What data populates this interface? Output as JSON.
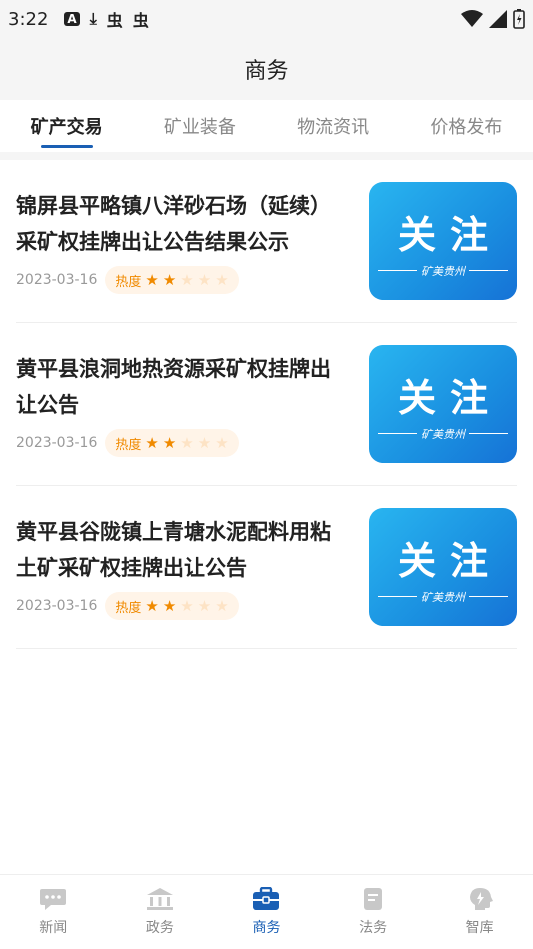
{
  "status_bar": {
    "time": "3:22",
    "left_icons": [
      "A",
      "⤓",
      "虫",
      "虫"
    ]
  },
  "header": {
    "title": "商务"
  },
  "tabs": [
    {
      "label": "矿产交易",
      "active": true
    },
    {
      "label": "矿业装备",
      "active": false
    },
    {
      "label": "物流资讯",
      "active": false
    },
    {
      "label": "价格发布",
      "active": false
    }
  ],
  "items": [
    {
      "title_line1": "锦屏县平略镇八洋砂石场（延续）",
      "title_line2": "采矿权挂牌出让公告结果公示",
      "date": "2023-03-16",
      "heat_label": "热度",
      "heat_stars": 2,
      "thumb_main": "关注",
      "thumb_sub": "矿美贵州"
    },
    {
      "title_line1": "黄平县浪洞地热资源采矿权挂牌出",
      "title_line2": "让公告",
      "date": "2023-03-16",
      "heat_label": "热度",
      "heat_stars": 2,
      "thumb_main": "关注",
      "thumb_sub": "矿美贵州"
    },
    {
      "title_line1": "黄平县谷陇镇上青塘水泥配料用粘",
      "title_line2": "土矿采矿权挂牌出让公告",
      "date": "2023-03-16",
      "heat_label": "热度",
      "heat_stars": 2,
      "thumb_main": "关注",
      "thumb_sub": "矿美贵州"
    }
  ],
  "bottom_nav": [
    {
      "label": "新闻",
      "icon": "chat-icon",
      "active": false
    },
    {
      "label": "政务",
      "icon": "government-building-icon",
      "active": false
    },
    {
      "label": "商务",
      "icon": "briefcase-icon",
      "active": true
    },
    {
      "label": "法务",
      "icon": "document-icon",
      "active": false
    },
    {
      "label": "智库",
      "icon": "brain-icon",
      "active": false
    }
  ],
  "colors": {
    "accent": "#1a5fb4",
    "heat": "#f08a00",
    "inactive": "#888888"
  }
}
